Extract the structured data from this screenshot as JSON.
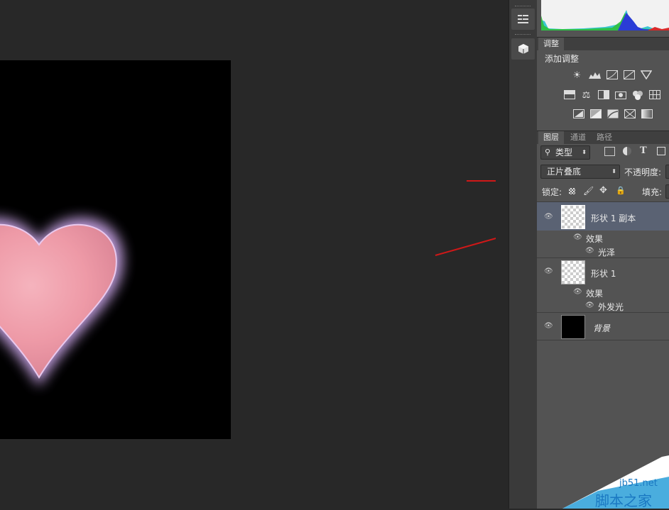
{
  "adjustments": {
    "tab": "调整",
    "add_adjustment": "添加调整",
    "rows": [
      [
        "brightness-icon",
        "levels-icon",
        "curves-icon",
        "exposure-icon",
        "vibrance-icon"
      ],
      [
        "hue-saturation-icon",
        "color-balance-icon",
        "black-white-icon",
        "photo-filter-icon",
        "channel-mixer-icon",
        "color-lookup-icon"
      ],
      [
        "invert-icon",
        "posterize-icon",
        "threshold-icon",
        "selective-color-icon",
        "gradient-map-icon"
      ]
    ]
  },
  "layers_panel": {
    "tabs": [
      "图层",
      "通道",
      "路径"
    ],
    "filter_kind": "类型",
    "blend_mode": "正片叠底",
    "opacity_label": "不透明度:",
    "lock_label": "锁定:",
    "fill_label": "填充:",
    "layers": [
      {
        "name": "形状 1 副本",
        "selected": true,
        "effects_label": "效果",
        "effects": [
          "光泽"
        ]
      },
      {
        "name": "形状 1",
        "selected": false,
        "effects_label": "效果",
        "effects": [
          "外发光"
        ]
      },
      {
        "name": "背景",
        "selected": false
      }
    ]
  },
  "watermark": {
    "site": "jb51.net",
    "brand": "脚本之家"
  },
  "colors": {
    "selected_layer": "#5a6273",
    "arrow": "#d01818",
    "heart_glow": "#d7b4ec"
  }
}
